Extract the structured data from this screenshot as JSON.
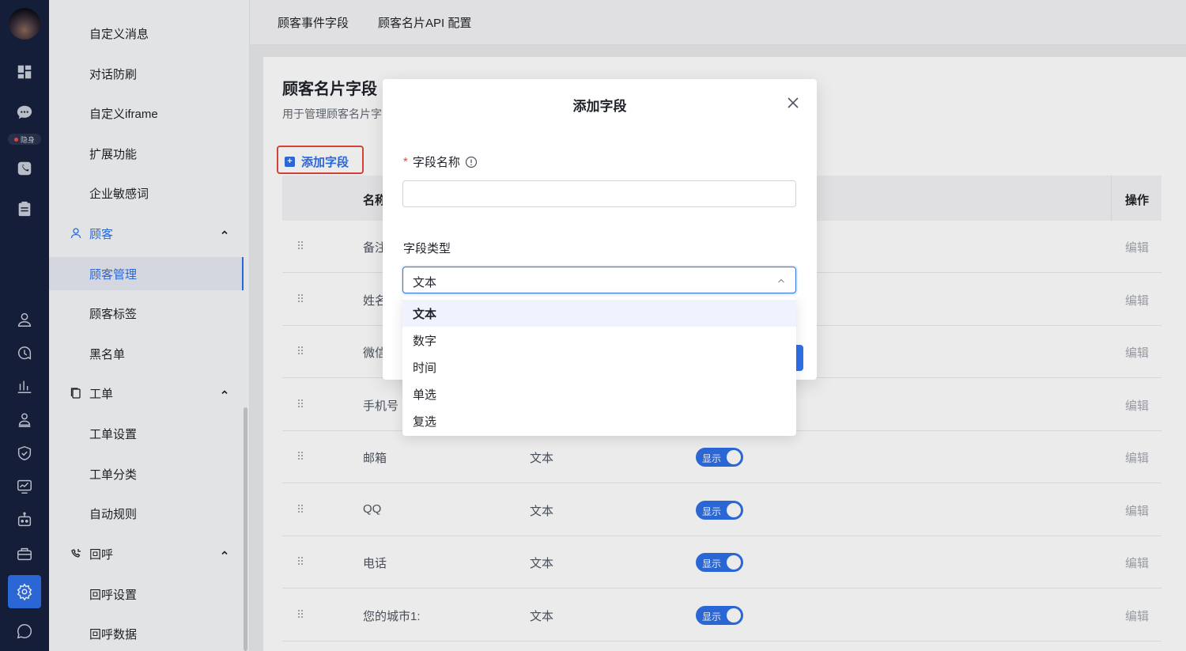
{
  "rail": {
    "status_badge": "隐身",
    "icons": [
      "dashboard-icon",
      "chat-icon",
      "phone-icon",
      "clipboard-icon",
      "user-icon",
      "clock-chat-icon",
      "bar-chart-icon",
      "users-icon",
      "shield-icon",
      "monitor-chart-icon",
      "robot-icon",
      "briefcase-icon",
      "settings-icon",
      "message-icon"
    ]
  },
  "sidebar": {
    "items": [
      {
        "label": "自定义消息"
      },
      {
        "label": "对话防刷"
      },
      {
        "label": "自定义iframe"
      },
      {
        "label": "扩展功能"
      },
      {
        "label": "企业敏感词"
      }
    ],
    "group_customer": "顾客",
    "customer_items": [
      {
        "label": "顾客管理"
      },
      {
        "label": "顾客标签"
      },
      {
        "label": "黑名单"
      }
    ],
    "group_ticket": "工单",
    "ticket_items": [
      {
        "label": "工单设置"
      },
      {
        "label": "工单分类"
      },
      {
        "label": "自动规则"
      }
    ],
    "group_callback": "回呼",
    "callback_items": [
      {
        "label": "回呼设置"
      },
      {
        "label": "回呼数据"
      }
    ]
  },
  "tabs": [
    {
      "label": "顾客事件字段"
    },
    {
      "label": "顾客名片API 配置"
    }
  ],
  "card": {
    "title": "顾客名片字段",
    "description": "用于管理顾客名片字",
    "add_button": "添加字段",
    "columns": {
      "name": "名称",
      "action": "操作"
    },
    "rows": [
      {
        "name": "备注",
        "type": "",
        "toggle": "",
        "action": "编辑"
      },
      {
        "name": "姓名",
        "type": "",
        "toggle": "",
        "action": "编辑"
      },
      {
        "name": "微信",
        "type": "",
        "toggle": "",
        "action": "编辑"
      },
      {
        "name": "手机号",
        "type": "",
        "toggle": "",
        "action": "编辑"
      },
      {
        "name": "邮箱",
        "type": "文本",
        "toggle": "显示",
        "action": "编辑"
      },
      {
        "name": "QQ",
        "type": "文本",
        "toggle": "显示",
        "action": "编辑"
      },
      {
        "name": "电话",
        "type": "文本",
        "toggle": "显示",
        "action": "编辑"
      },
      {
        "name": "您的城市1:",
        "type": "文本",
        "toggle": "显示",
        "action": "编辑"
      }
    ]
  },
  "modal": {
    "title": "添加字段",
    "field_name_label": "字段名称",
    "required_mark": "*",
    "field_name_value": "",
    "field_type_label": "字段类型",
    "field_type_value": "文本",
    "options": [
      {
        "label": "文本",
        "selected": true
      },
      {
        "label": "数字",
        "selected": false
      },
      {
        "label": "时间",
        "selected": false
      },
      {
        "label": "单选",
        "selected": false
      },
      {
        "label": "复选",
        "selected": false
      }
    ]
  },
  "colors": {
    "accent": "#2f6fe8",
    "rail_bg": "#17213d",
    "highlight_border": "#e5483c",
    "required": "#e5483c"
  }
}
